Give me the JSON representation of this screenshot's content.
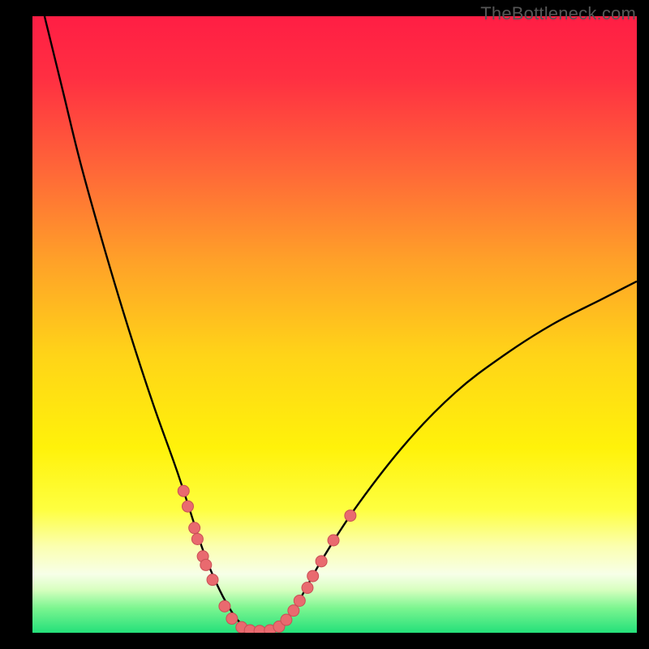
{
  "watermark": "TheBottleneck.com",
  "colors": {
    "gradient_stops": [
      {
        "offset": 0.0,
        "color": "#ff1e44"
      },
      {
        "offset": 0.1,
        "color": "#ff2f42"
      },
      {
        "offset": 0.25,
        "color": "#ff6738"
      },
      {
        "offset": 0.4,
        "color": "#ffa228"
      },
      {
        "offset": 0.55,
        "color": "#ffd418"
      },
      {
        "offset": 0.7,
        "color": "#fff20a"
      },
      {
        "offset": 0.8,
        "color": "#feff40"
      },
      {
        "offset": 0.86,
        "color": "#fbffb0"
      },
      {
        "offset": 0.905,
        "color": "#f7ffe8"
      },
      {
        "offset": 0.93,
        "color": "#d8ffc0"
      },
      {
        "offset": 0.96,
        "color": "#7bf590"
      },
      {
        "offset": 1.0,
        "color": "#24e07a"
      }
    ],
    "curve_stroke": "#000000",
    "marker_fill": "#e96a6f",
    "marker_stroke": "#c94f55",
    "frame_bg": "#000000"
  },
  "chart_data": {
    "type": "line",
    "title": "",
    "xlabel": "",
    "ylabel": "",
    "xlim": [
      0,
      100
    ],
    "ylim": [
      0,
      100
    ],
    "series": [
      {
        "name": "bottleneck-curve",
        "x": [
          2,
          5,
          8,
          12,
          16,
          20,
          24,
          28,
          30,
          32,
          34,
          36,
          38,
          40,
          42,
          44,
          48,
          54,
          62,
          70,
          78,
          86,
          94,
          100
        ],
        "y": [
          100,
          88,
          76,
          62,
          49,
          37,
          26,
          14,
          9,
          5,
          2,
          0.5,
          0.3,
          0.5,
          2,
          5,
          12,
          21,
          31,
          39,
          45,
          50,
          54,
          57
        ]
      }
    ],
    "markers": [
      {
        "x": 25.0,
        "y": 23.0
      },
      {
        "x": 25.7,
        "y": 20.5
      },
      {
        "x": 26.8,
        "y": 17.0
      },
      {
        "x": 27.3,
        "y": 15.2
      },
      {
        "x": 28.2,
        "y": 12.4
      },
      {
        "x": 28.7,
        "y": 11.0
      },
      {
        "x": 29.8,
        "y": 8.6
      },
      {
        "x": 31.8,
        "y": 4.3
      },
      {
        "x": 33.0,
        "y": 2.3
      },
      {
        "x": 34.6,
        "y": 0.9
      },
      {
        "x": 36.0,
        "y": 0.4
      },
      {
        "x": 37.6,
        "y": 0.3
      },
      {
        "x": 39.3,
        "y": 0.4
      },
      {
        "x": 40.8,
        "y": 1.0
      },
      {
        "x": 42.0,
        "y": 2.1
      },
      {
        "x": 43.2,
        "y": 3.6
      },
      {
        "x": 44.2,
        "y": 5.2
      },
      {
        "x": 45.5,
        "y": 7.3
      },
      {
        "x": 46.4,
        "y": 9.2
      },
      {
        "x": 47.8,
        "y": 11.6
      },
      {
        "x": 49.8,
        "y": 15.0
      },
      {
        "x": 52.6,
        "y": 19.0
      }
    ],
    "marker_radius": 7
  }
}
